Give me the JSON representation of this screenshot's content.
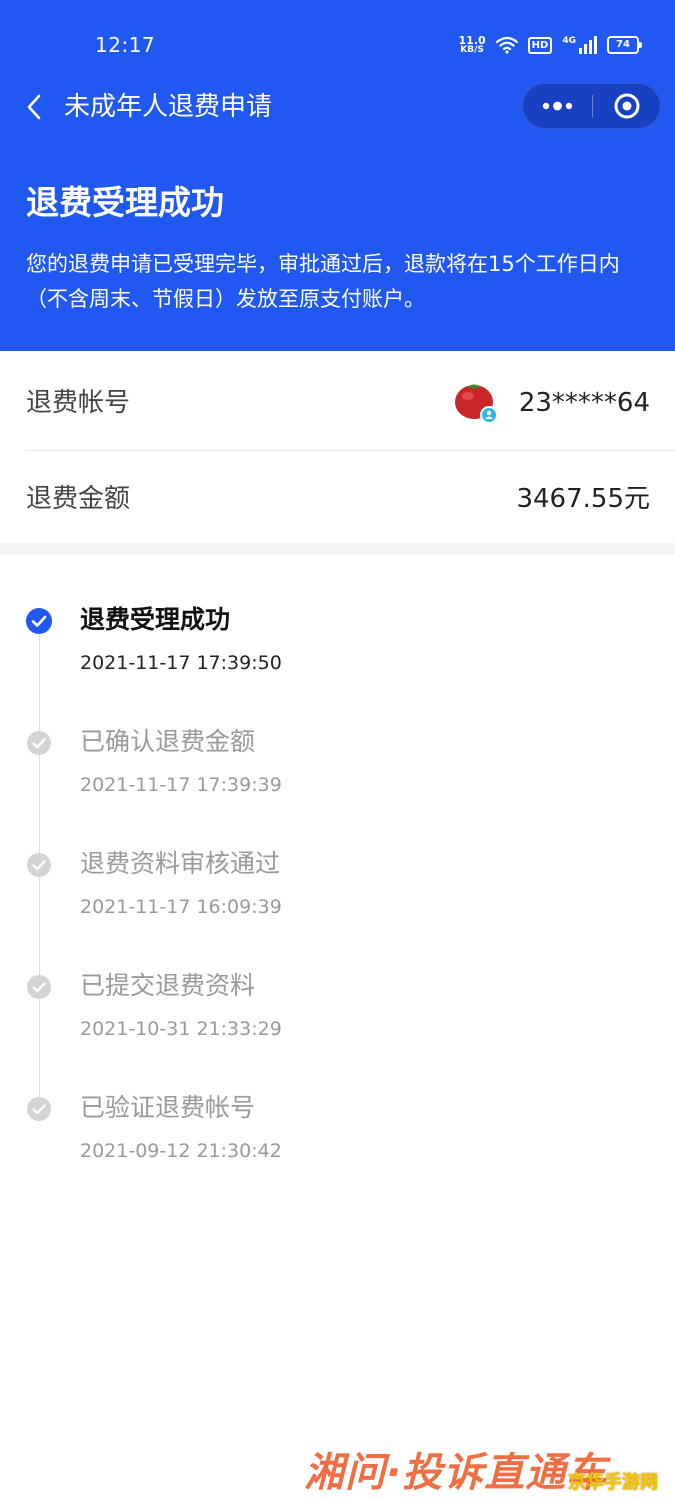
{
  "status_bar": {
    "time": "12:17",
    "net_speed_value": "11.0",
    "net_speed_unit": "KB/S",
    "hd": "HD",
    "signal_type": "4G",
    "battery": "74"
  },
  "nav": {
    "title": "未成年人退费申请"
  },
  "header": {
    "title": "退费受理成功",
    "description": "您的退费申请已受理完毕，审批通过后，退款将在15个工作日内（不含周末、节假日）发放至原支付账户。"
  },
  "info": {
    "account_label": "退费帐号",
    "account_value": "23*****64",
    "amount_label": "退费金额",
    "amount_value": "3467.55元"
  },
  "timeline": [
    {
      "title": "退费受理成功",
      "time": "2021-11-17 17:39:50",
      "active": true
    },
    {
      "title": "已确认退费金额",
      "time": "2021-11-17 17:39:39",
      "active": false
    },
    {
      "title": "退费资料审核通过",
      "time": "2021-11-17 16:09:39",
      "active": false
    },
    {
      "title": "已提交退费资料",
      "time": "2021-10-31 21:33:29",
      "active": false
    },
    {
      "title": "已验证退费帐号",
      "time": "2021-09-12 21:30:42",
      "active": false
    }
  ],
  "watermark": {
    "main": "湘问·投诉直通车",
    "corner": "京华手游网"
  },
  "colors": {
    "brand_blue": "#2158F0",
    "check_active": "#2158F0",
    "check_inactive": "#d0d0d0"
  },
  "icons": {
    "back": "chevron-left-icon",
    "more": "more-dots-icon",
    "close": "target-circle-icon",
    "active_step": "check-circle-icon",
    "done_step": "check-circle-gray-icon"
  }
}
